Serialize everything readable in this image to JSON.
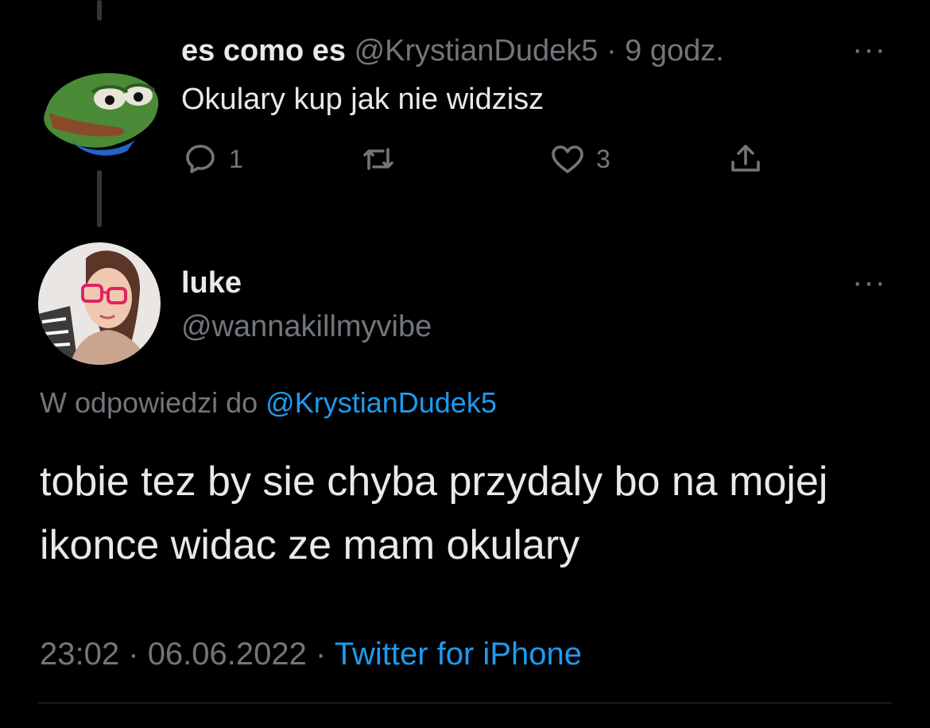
{
  "reply_tweet": {
    "display_name": "es como es",
    "handle": "@KrystianDudek5",
    "separator": "·",
    "time": "9 godz.",
    "text": "Okulary kup jak nie widzisz",
    "more": "···",
    "actions": {
      "reply_count": "1",
      "like_count": "3"
    }
  },
  "main_tweet": {
    "display_name": "luke",
    "handle": "@wannakillmyvibe",
    "more": "···",
    "replying_prefix": "W odpowiedzi do",
    "replying_to": "@KrystianDudek5",
    "text": "tobie tez by sie chyba przydaly bo na mojej ikonce widac ze mam okulary",
    "time": "23:02",
    "dot1": "·",
    "date": "06.06.2022",
    "dot2": "·",
    "source": "Twitter for iPhone"
  },
  "colors": {
    "background": "#000000",
    "text": "#e7e9ea",
    "muted": "#71767b",
    "link": "#1d9bf0"
  }
}
